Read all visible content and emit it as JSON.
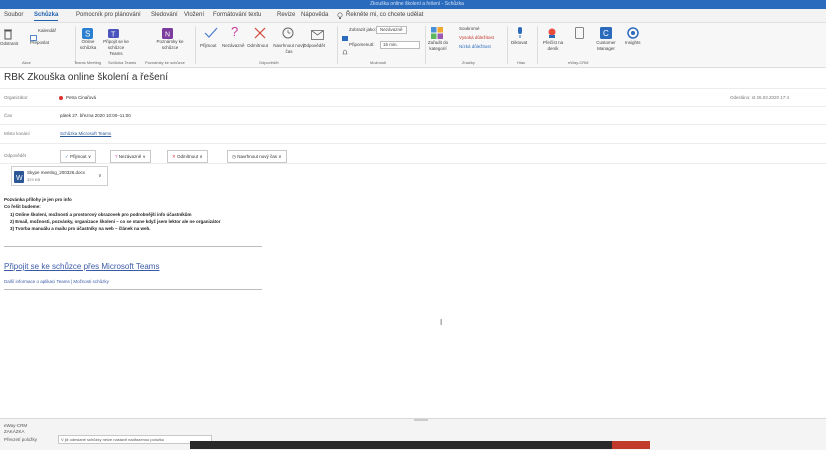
{
  "window": {
    "title": "Zkouška online školení a řešení - Schůzka"
  },
  "tabs": [
    {
      "label": "Soubor"
    },
    {
      "label": "Schůzka",
      "active": true
    },
    {
      "label": "Pomocník pro plánování"
    },
    {
      "label": "Sledování"
    },
    {
      "label": "Vložení"
    },
    {
      "label": "Formátování textu"
    },
    {
      "label": "Revize"
    },
    {
      "label": "Nápověda"
    },
    {
      "label": "Řekněte mi, co chcete udělat"
    }
  ],
  "ribbon": {
    "delete": "Odstranit",
    "calendar": "Kalendář",
    "forward": "Přeposlat",
    "join_teams": "Připojit se ke schůzce Teams",
    "online_meeting": "Online schůzka",
    "meeting_notes": "Poznámky ke schůzce",
    "accept": "Přijmout",
    "tentative": "Nezávazně",
    "decline": "Odmítnout",
    "propose": "Navrhnout nový čas",
    "respond": "Odpovědět",
    "show_as": "Zobrazit jako:",
    "show_as_value": "Nezávazně",
    "reminder": "Připomenutí:",
    "reminder_value": "15 min.",
    "categorize": "Zařadit do kategorií",
    "private": "Soukromé",
    "high_importance": "Vysoká důležitost",
    "low_importance": "Nízká důležitost",
    "dictate": "Diktovat",
    "tracking": "Přečíst na deník",
    "customer_manager": "Customer Manager",
    "insights": "Insights",
    "groups": [
      "Akce",
      "Teams Meeting",
      "Schůzka Teams",
      "Poznámky ke schůzce",
      "Odpovědět",
      "Možnosti",
      "Značky",
      "Hlas",
      "eWay-CRM"
    ]
  },
  "subject": "RBK Zkouška online školení a řešení",
  "fields": {
    "organizer_label": "Organizátor",
    "organizer_value": "Petra Cinařová",
    "time_label": "Čas",
    "time_value": "pátek 27. března 2020 10:00–11:00",
    "location_label": "Místo konání",
    "location_value": "Schůzka Microsoft Teams",
    "sent": "Odesláno:  st 26.03.2020 17:4",
    "response_label": "Odpovědět"
  },
  "responses": [
    "Přijmout",
    "Nezávazně",
    "Odmítnout",
    "Navrhnout nový čas"
  ],
  "attachment": {
    "name": "Skype meeting_200326.docx",
    "size": "329 KB"
  },
  "body": {
    "line1": "Pozvánka přílohy je jen pro info",
    "line2": "Co řešit budeme:",
    "items": [
      "1)   Online školení, možnosti a prostorový obrazovek pro podrobnější info účastníkům",
      "2)   Email, možnosti, pozvánky, organizace školení – co se stane když jsem lektor ale ne organizátor",
      "3)   Tvorba manuálu a mailu pro účastníky na web – článek na web."
    ],
    "teams_link": "Připojit se ke schůzce přes Microsoft Teams",
    "teams_sub": "Další informace o aplikaci Teams | Možnosti schůzky"
  },
  "bottom": {
    "line1": "eWay-CRM",
    "line2": "ZAKÁZKA",
    "line3": "Převzetí položky",
    "dropdown": "V již odeslané schůzky nelze nastavit nadřazenou položku"
  }
}
